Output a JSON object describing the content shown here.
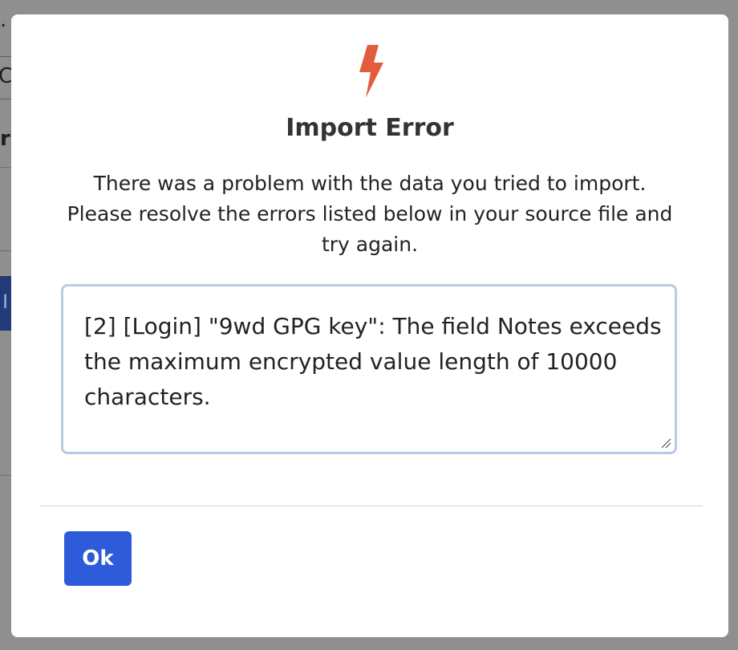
{
  "background": {
    "fragment_dot": ".",
    "fragment_c": "C",
    "fragment_r": "r",
    "fragment_i": "I"
  },
  "dialog": {
    "icon": "lightning-bolt-icon",
    "icon_color": "#e25c3d",
    "title": "Import Error",
    "message": "There was a problem with the data you tried to import. Please resolve the errors listed below in your source file and try again.",
    "error_text": "[2] [Login] \"9wd GPG key\": The field Notes exceeds the maximum encrypted value length of 10000 characters.",
    "ok_label": "Ok",
    "button_color": "#2d5bd9"
  }
}
